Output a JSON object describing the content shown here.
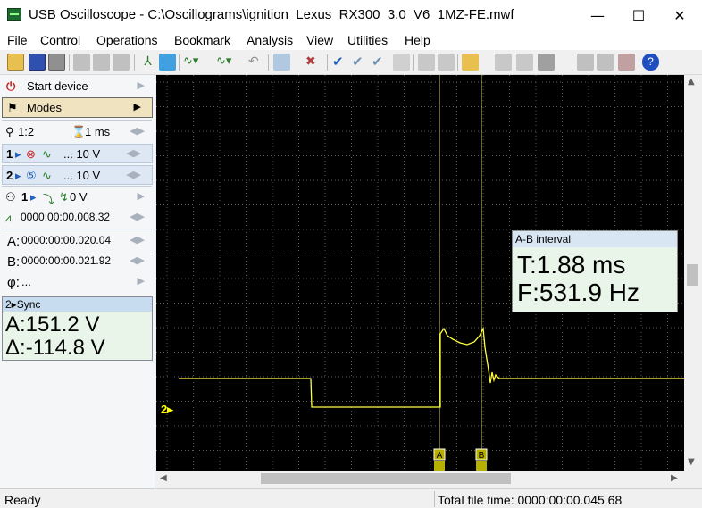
{
  "window": {
    "title": "USB Oscilloscope - C:\\Oscillograms\\ignition_Lexus_RX300_3.0_V6_1MZ-FE.mwf",
    "minimize": "—",
    "maximize": "☐",
    "close": "✕"
  },
  "menu": [
    "File",
    "Control",
    "Operations",
    "Bookmark",
    "Analysis",
    "View",
    "Utilities",
    "Help"
  ],
  "panel": {
    "start_device": "Start device",
    "modes": "Modes",
    "zoom": "1:2",
    "timebase": "1 ms",
    "ch1_label": "1",
    "ch1_volts": "... 10 V",
    "ch2_label": "2",
    "ch2_volts": "... 10 V",
    "trigger_channel": "1",
    "trigger_level": "0 V",
    "trigger_time": "0000:00:00.008.32",
    "cursor_a_label": "A:",
    "cursor_a_time": "0000:00:00.020.04",
    "cursor_b_label": "B:",
    "cursor_b_time": "0000:00:00.021.92",
    "phase_label": "φ:",
    "phase_value": "..."
  },
  "sync": {
    "header": "2▸Sync",
    "a_value": "A:151.2 V",
    "delta_value": "Δ:-114.8 V"
  },
  "ab_interval": {
    "header": "A-B interval",
    "period": "T:1.88 ms",
    "frequency": "F:531.9 Hz"
  },
  "scope": {
    "channel_marker": "2▸",
    "cursor_a": "A",
    "cursor_b": "B",
    "trace_color": "#ffff40",
    "grid_color": "#5a5a5a",
    "cursor_color": "#c8c870"
  },
  "status": {
    "ready": "Ready",
    "total_time": "Total file time: 0000:00:00.045.68"
  },
  "colors": {
    "accent": "#c81e1e",
    "panel_blue": "#dde8f4",
    "readout_bg": "#e8f5e8"
  }
}
